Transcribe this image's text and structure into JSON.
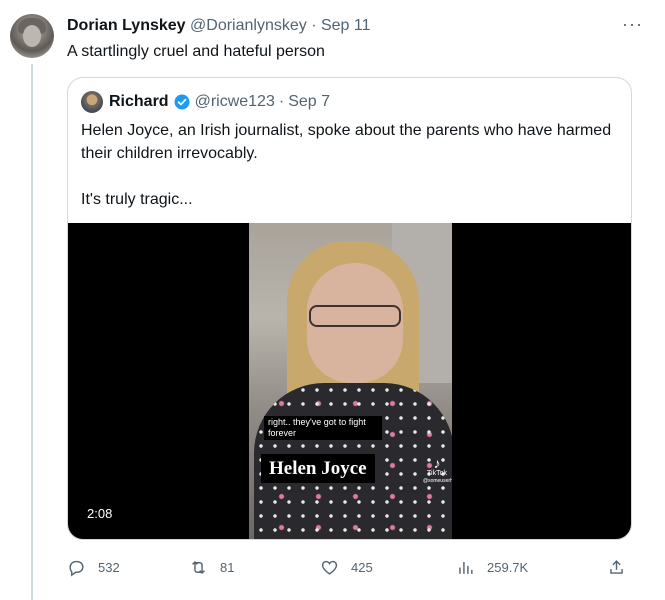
{
  "tweet": {
    "author_name": "Dorian Lynskey",
    "author_handle": "@Dorianlynskey",
    "separator": "·",
    "date": "Sep 11",
    "text": "A startlingly cruel and hateful person",
    "more_icon": "more-icon"
  },
  "quote": {
    "author_name": "Richard",
    "verified_icon": "verified-badge-icon",
    "author_handle": "@ricwe123",
    "separator": "·",
    "date": "Sep 7",
    "text_line1": "Helen Joyce, an Irish journalist, spoke about the parents who have harmed their children irrevocably.",
    "text_line2": "It's truly tragic...",
    "media": {
      "caption": "right.. they've got to fight forever",
      "name_card": "Helen Joyce",
      "watermark_brand": "TikTok",
      "watermark_handle": "@someuserhandle",
      "duration": "2:08"
    }
  },
  "actions": {
    "replies": "532",
    "retweets": "81",
    "likes": "425",
    "views": "259.7K"
  },
  "colors": {
    "text_primary": "#0f1419",
    "text_secondary": "#536471",
    "border": "#cfd9de",
    "verified": "#1d9bf0"
  }
}
